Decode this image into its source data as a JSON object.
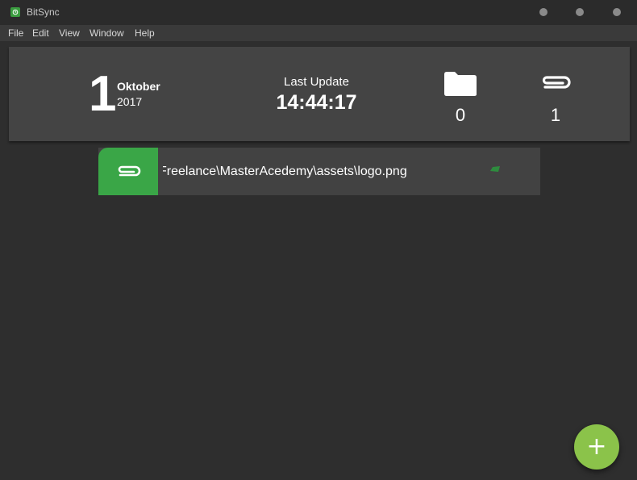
{
  "window": {
    "title": "BitSync",
    "controls": [
      "minimize",
      "maximize",
      "close"
    ]
  },
  "menu": {
    "items": [
      "File",
      "Edit",
      "View",
      "Window",
      "Help"
    ]
  },
  "header": {
    "day": "1",
    "month": "Oktober",
    "year": "2017",
    "last_update_label": "Last Update",
    "last_update_time": "14:44:17",
    "folders_count": "0",
    "files_count": "1",
    "folders_icon": "folder-icon",
    "files_icon": "paperclip-icon"
  },
  "sync_items": [
    {
      "type_icon": "paperclip-icon",
      "path": "Freelance\\MasterAcedemy\\assets\\logo.png",
      "status_icon": "sync-status-icon"
    }
  ],
  "fab": {
    "label": "+"
  },
  "colors": {
    "background": "#2e2e2e",
    "card": "#444444",
    "accent_green": "#3aa647",
    "fab_green": "#8bc34a"
  }
}
